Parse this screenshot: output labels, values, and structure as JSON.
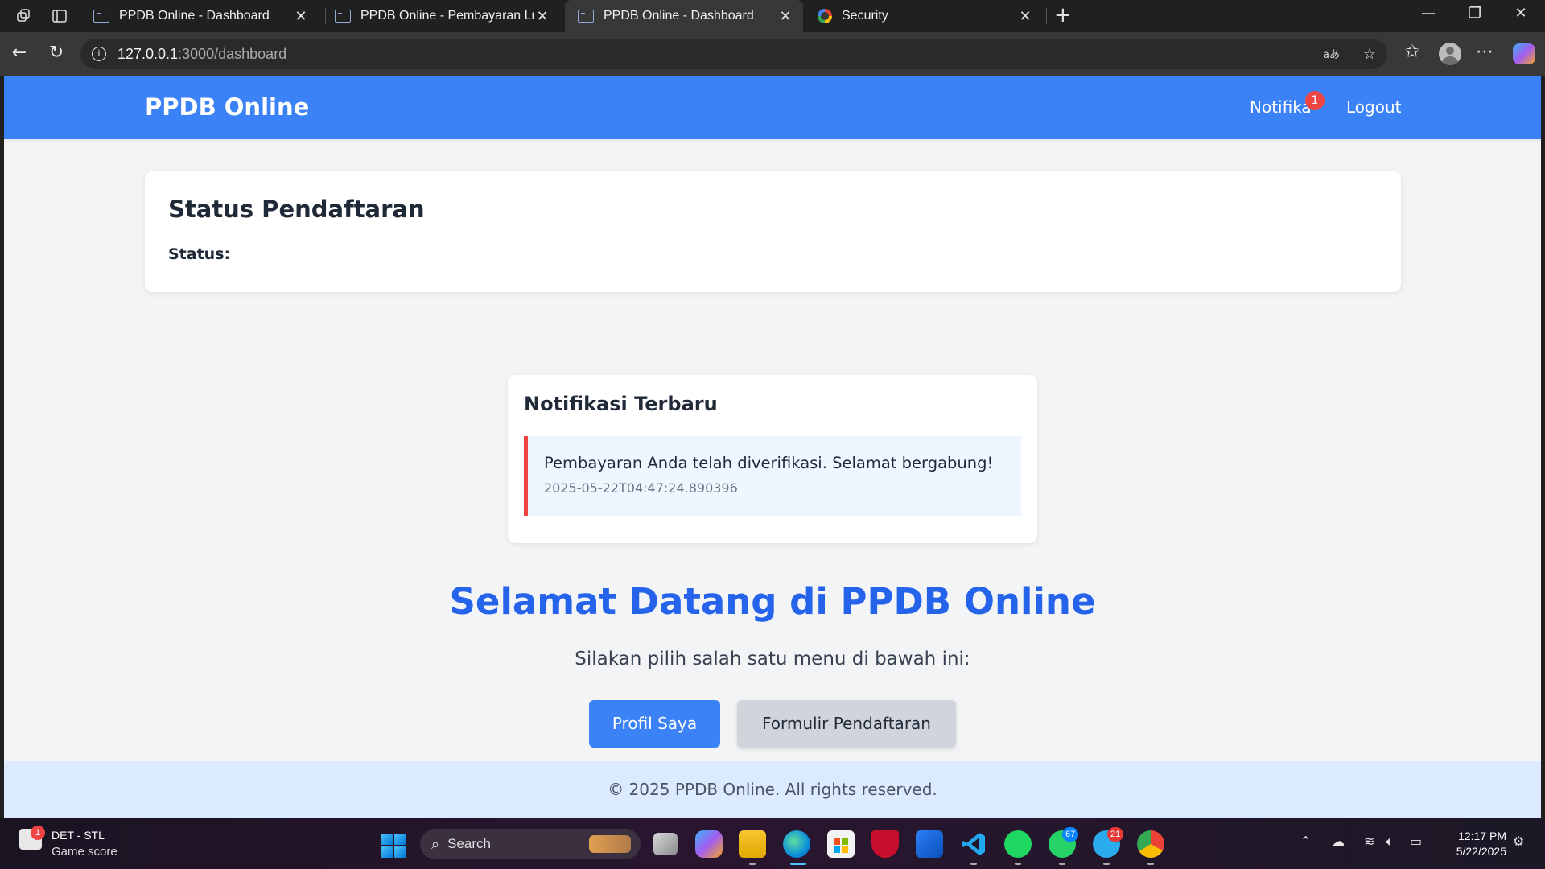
{
  "browser": {
    "tabs": [
      {
        "title": "PPDB Online - Dashboard",
        "active": false
      },
      {
        "title": "PPDB Online - Pembayaran Lunas",
        "active": false
      },
      {
        "title": "PPDB Online - Dashboard",
        "active": true
      },
      {
        "title": "Security",
        "active": false
      }
    ],
    "url_host": "127.0.0.1",
    "url_path": ":3000/dashboard"
  },
  "site": {
    "brand": "PPDB Online",
    "nav": {
      "notifications_label": "Notifika",
      "notifications_count": "1",
      "logout_label": "Logout"
    },
    "status_card": {
      "title": "Status Pendaftaran",
      "status_label": "Status:"
    },
    "notifications": {
      "title": "Notifikasi Terbaru",
      "items": [
        {
          "message": "Pembayaran Anda telah diverifikasi. Selamat bergabung!",
          "timestamp": "2025-05-22T04:47:24.890396"
        }
      ]
    },
    "welcome": {
      "title": "Selamat Datang di PPDB Online",
      "subtitle": "Silakan pilih salah satu menu di bawah ini:"
    },
    "buttons": {
      "profile": "Profil Saya",
      "form": "Formulir Pendaftaran"
    },
    "footer": "© 2025 PPDB Online. All rights reserved."
  },
  "taskbar": {
    "game_widget": {
      "title": "DET - STL",
      "subtitle": "Game score",
      "badge": "1"
    },
    "search_label": "Search",
    "badges": {
      "whatsapp": "67",
      "telegram": "21"
    },
    "clock": {
      "time": "12:17 PM",
      "date": "5/22/2025"
    }
  },
  "colors": {
    "primary": "#3b82f6",
    "heading_blue": "#2563eb",
    "danger": "#ef4444",
    "footer_bg": "#dbeafe",
    "page_bg": "#f3f4f6"
  }
}
